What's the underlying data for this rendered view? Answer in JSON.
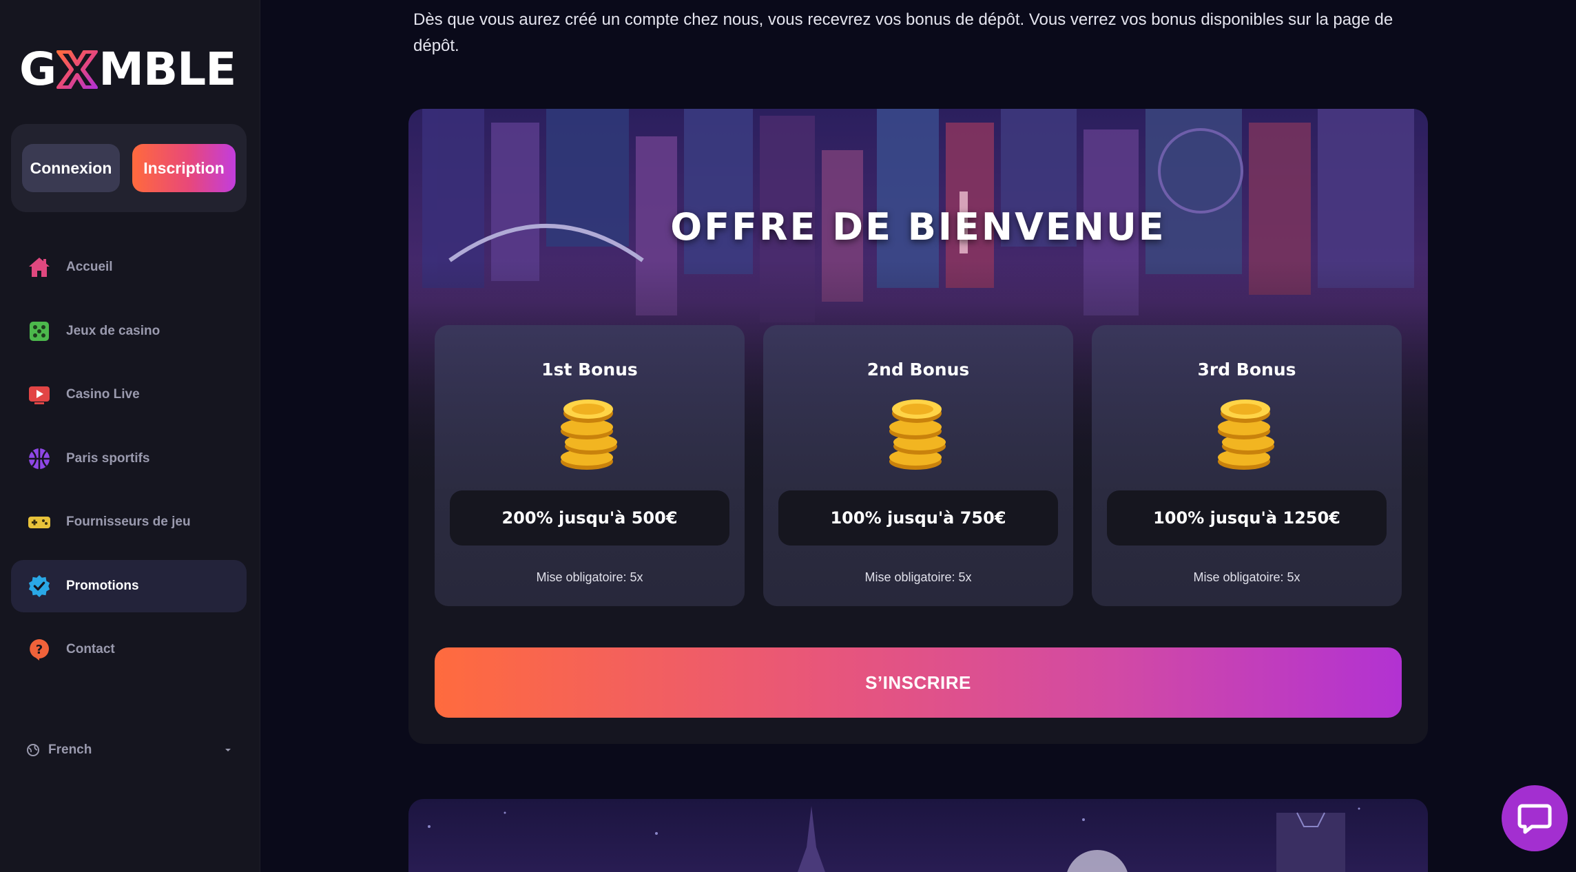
{
  "brand": {
    "logo_text_left": "G",
    "logo_text_right": "MBLE"
  },
  "auth": {
    "login_label": "Connexion",
    "signup_label": "Inscription"
  },
  "sidebar": {
    "items": [
      {
        "label": "Accueil",
        "icon": "home-icon",
        "color": "#e0487f"
      },
      {
        "label": "Jeux de casino",
        "icon": "dice-icon",
        "color": "#4cb84c"
      },
      {
        "label": "Casino Live",
        "icon": "live-play-icon",
        "color": "#e24545"
      },
      {
        "label": "Paris sportifs",
        "icon": "basketball-icon",
        "color": "#8e47e6"
      },
      {
        "label": "Fournisseurs de jeu",
        "icon": "gamepad-icon",
        "color": "#e8c23a"
      },
      {
        "label": "Promotions",
        "icon": "badge-check-icon",
        "color": "#2aa8e6",
        "active": true
      },
      {
        "label": "Contact",
        "icon": "help-icon",
        "color": "#f0623a"
      }
    ],
    "language": "French"
  },
  "main": {
    "intro": "Dès que vous aurez créé un compte chez nous, vous recevrez vos bonus de dépôt. Vous verrez vos bonus disponibles sur la page de dépôt.",
    "welcome": {
      "title": "OFFRE DE BIENVENUE",
      "cards": [
        {
          "title": "1st Bonus",
          "amount": "200% jusqu'à 500€",
          "wager": "Mise obligatoire: 5x"
        },
        {
          "title": "2nd Bonus",
          "amount": "100% jusqu'à 750€",
          "wager": "Mise obligatoire: 5x"
        },
        {
          "title": "3rd Bonus",
          "amount": "100% jusqu'à 1250€",
          "wager": "Mise obligatoire: 5x"
        }
      ],
      "cta_label": "S’INSCRIRE"
    }
  },
  "colors": {
    "accent_gradient_start": "#ff6b3e",
    "accent_gradient_end": "#b232d2",
    "sidebar_bg": "#15151f",
    "page_bg": "#0a0a1a"
  }
}
